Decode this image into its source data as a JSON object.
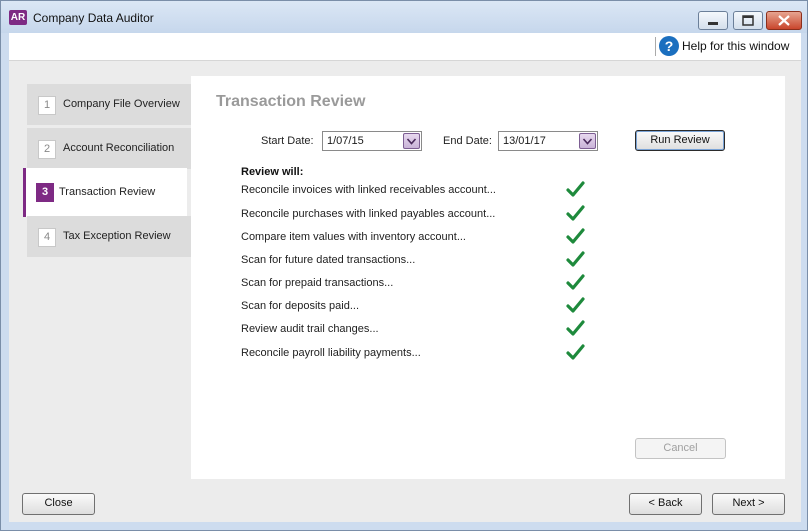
{
  "window": {
    "app_icon": "AR",
    "title": "Company Data Auditor",
    "controls": [
      "minimize-icon",
      "maximize-icon",
      "close-icon"
    ]
  },
  "help": {
    "icon": "?",
    "label": "Help for this window"
  },
  "sidebar": {
    "steps": [
      {
        "num": "1",
        "label": "Company File Overview",
        "active": false
      },
      {
        "num": "2",
        "label": "Account Reconciliation",
        "active": false
      },
      {
        "num": "3",
        "label": "Transaction Review",
        "active": true
      },
      {
        "num": "4",
        "label": "Tax Exception Review",
        "active": false
      }
    ]
  },
  "panel": {
    "title": "Transaction Review",
    "start_date_label": "Start Date:",
    "start_date_value": "1/07/15",
    "end_date_label": "End Date:",
    "end_date_value": "13/01/17",
    "run_button": "Run Review",
    "review_heading": "Review will:",
    "review_items": [
      {
        "text": "Reconcile invoices with linked receivables account...",
        "status": "check-icon"
      },
      {
        "text": "Reconcile purchases with linked payables account...",
        "status": "check-icon"
      },
      {
        "text": "Compare item values with inventory account...",
        "status": "check-icon"
      },
      {
        "text": "Scan for future dated transactions...",
        "status": "check-icon"
      },
      {
        "text": "Scan for prepaid transactions...",
        "status": "check-icon"
      },
      {
        "text": "Scan for deposits paid...",
        "status": "check-icon"
      },
      {
        "text": "Review audit trail changes...",
        "status": "check-icon"
      },
      {
        "text": "Reconcile payroll liability payments...",
        "status": "check-icon"
      }
    ],
    "cancel_button": "Cancel"
  },
  "footer": {
    "close_button": "Close",
    "back_button": "< Back",
    "next_button": "Next >"
  },
  "colors": {
    "accent": "#7e2a84",
    "check": "#1e8a3c",
    "help_icon": "#1b6fbf"
  }
}
